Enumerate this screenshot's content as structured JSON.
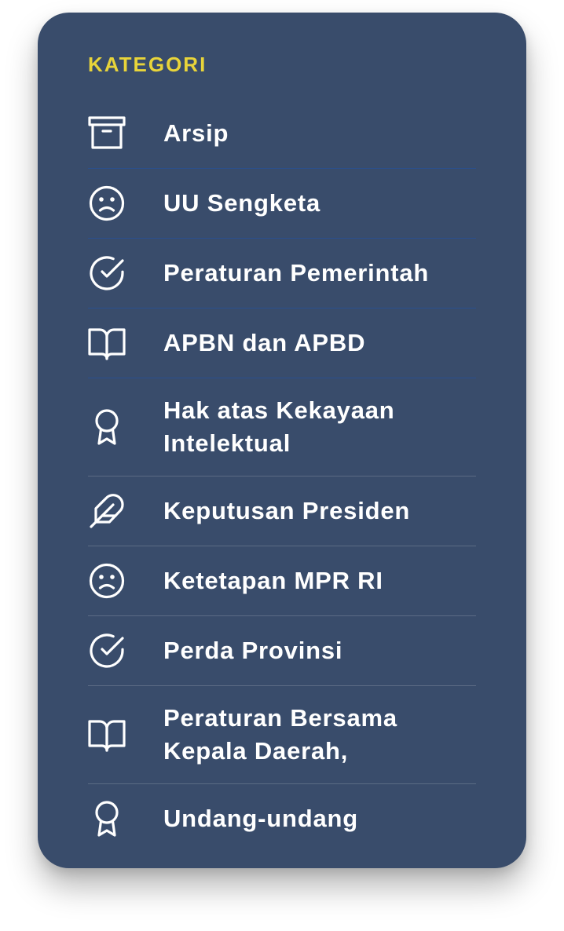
{
  "category_heading": "KATEGORI",
  "colors": {
    "card_background": "#394c6b",
    "heading": "#e8d43a",
    "text": "#ffffff",
    "divider_blue": "#2a4f8e",
    "divider_gray": "#5b6b84"
  },
  "categories": [
    {
      "label": "Arsip",
      "icon": "archive-icon"
    },
    {
      "label": "UU Sengketa",
      "icon": "frown-face-icon"
    },
    {
      "label": "Peraturan Pemerintah",
      "icon": "check-circle-icon"
    },
    {
      "label": "APBN dan APBD",
      "icon": "open-book-icon"
    },
    {
      "label": "Hak atas Kekayaan\nIntelektual",
      "icon": "award-icon"
    },
    {
      "label": "Keputusan Presiden",
      "icon": "feather-icon"
    },
    {
      "label": "Ketetapan MPR RI",
      "icon": "frown-face-icon"
    },
    {
      "label": "Perda Provinsi",
      "icon": "check-circle-icon"
    },
    {
      "label": "Peraturan Bersama\nKepala Daerah,",
      "icon": "open-book-icon"
    },
    {
      "label": "Undang-undang",
      "icon": "award-icon"
    }
  ]
}
